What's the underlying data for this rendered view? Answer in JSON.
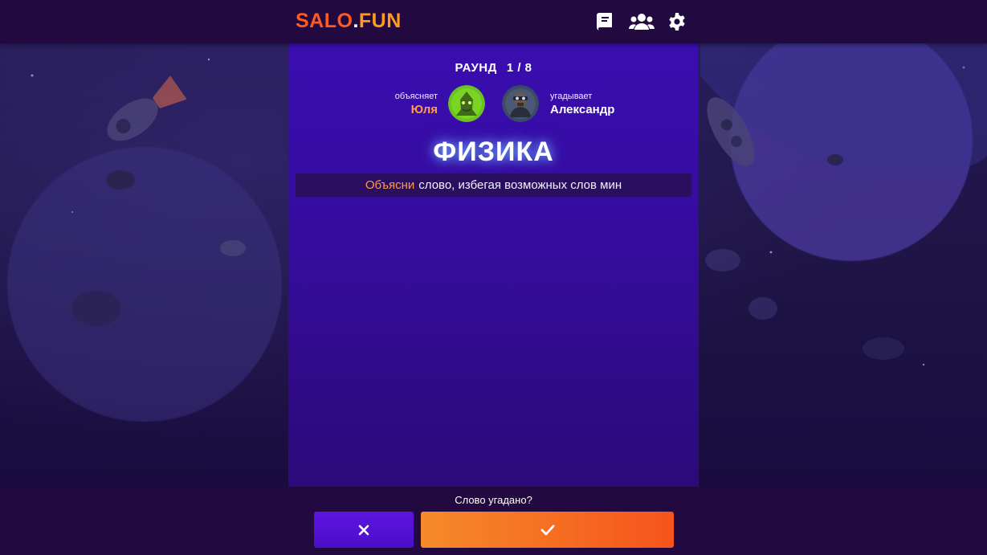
{
  "header": {
    "logo_part1": "SALO",
    "logo_dot": ".",
    "logo_part2": "FUN",
    "icons": [
      "book-icon",
      "users-icon",
      "gear-icon"
    ]
  },
  "round": {
    "label": "РАУНД",
    "value": "1 / 8"
  },
  "explainer": {
    "role": "объясняет",
    "name": "Юля"
  },
  "guesser": {
    "role": "угадывает",
    "name": "Александр"
  },
  "word": "ФИЗИКА",
  "hint": {
    "highlight": "Объясни",
    "text": "слово, избегая возможных слов мин"
  },
  "bottom": {
    "question": "Слово угадано?",
    "no_icon": "close-icon",
    "yes_icon": "check-icon"
  },
  "colors": {
    "accent_orange": "#ff9a48",
    "logo_red": "#ff5a1f",
    "panel_purple": "#3a0db0",
    "header_bg": "#22093f"
  }
}
